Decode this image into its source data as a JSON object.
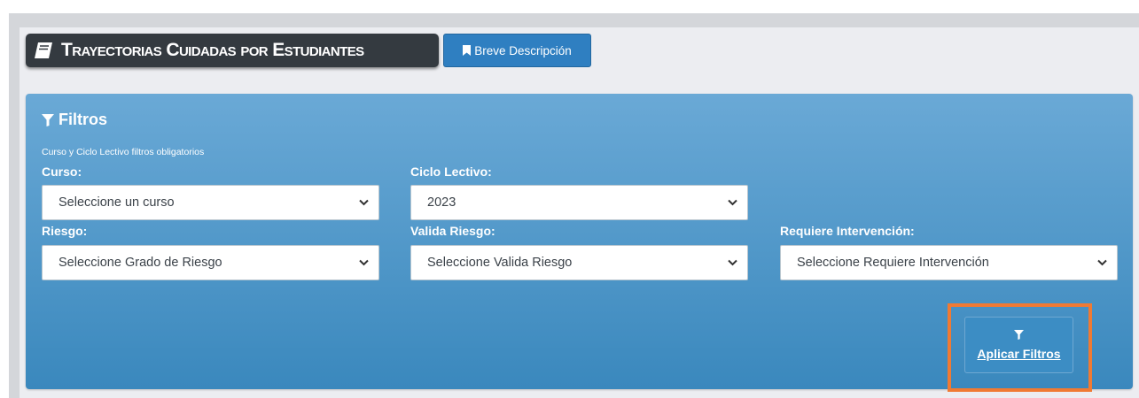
{
  "header": {
    "title": "Trayectorias Cuidadas por Estudiantes",
    "description_button": "Breve Descripción"
  },
  "filters": {
    "title": "Filtros",
    "note": "Curso y Ciclo Lectivo filtros obligatorios",
    "curso": {
      "label": "Curso:",
      "value": "Seleccione un curso"
    },
    "ciclo": {
      "label": "Ciclo Lectivo:",
      "value": "2023"
    },
    "riesgo": {
      "label": "Riesgo:",
      "value": "Seleccione Grado de Riesgo"
    },
    "valida": {
      "label": "Valida Riesgo:",
      "value": "Seleccione Valida Riesgo"
    },
    "interv": {
      "label": "Requiere Intervención:",
      "value": "Seleccione Requiere Intervención"
    },
    "apply_button": "Aplicar Filtros"
  },
  "colors": {
    "highlight": "#f07a33",
    "title_badge": "#343a40",
    "primary_button": "#2f7fc1"
  }
}
